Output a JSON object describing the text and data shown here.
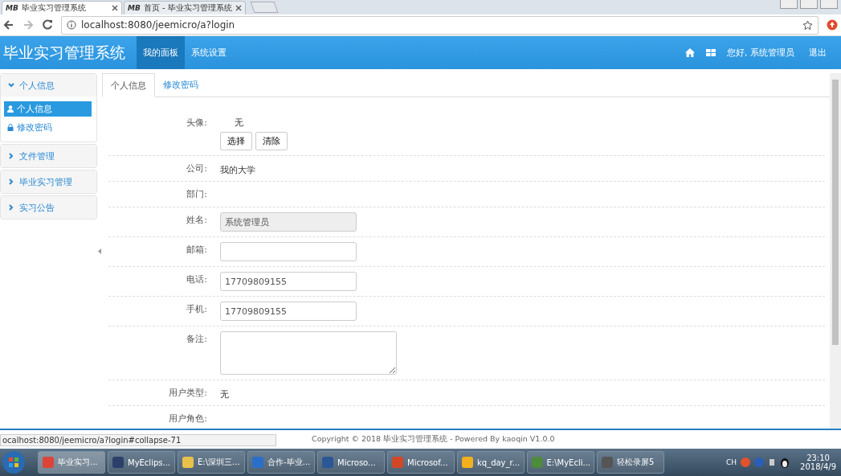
{
  "browser": {
    "tabs": [
      {
        "icon_text": "MB",
        "label": "毕业实习管理系统",
        "selected": true
      },
      {
        "icon_text": "MB",
        "label": "首页 - 毕业实习管理系统",
        "selected": false
      }
    ],
    "address": "localhost:8080/jeemicro/a?login"
  },
  "header": {
    "brand": "毕业实习管理系统",
    "nav": [
      {
        "label": "我的面板",
        "selected": true
      },
      {
        "label": "系统设置",
        "selected": false
      }
    ],
    "greeting": "您好, 系统管理员",
    "logout": "退出"
  },
  "sidebar": {
    "groups": [
      {
        "title": "个人信息",
        "expanded": true,
        "items": [
          {
            "label": "个人信息",
            "kind": "user",
            "selected": true
          },
          {
            "label": "修改密码",
            "kind": "lock",
            "selected": false
          }
        ]
      },
      {
        "title": "文件管理",
        "expanded": false
      },
      {
        "title": "毕业实习管理",
        "expanded": false
      },
      {
        "title": "实习公告",
        "expanded": false
      }
    ]
  },
  "tabs": [
    {
      "label": "个人信息",
      "selected": true
    },
    {
      "label": "修改密码",
      "selected": false
    }
  ],
  "form": {
    "rows": [
      {
        "kind": "avatar",
        "label": "头像:",
        "value": "无",
        "buttons": [
          "选择",
          "清除"
        ]
      },
      {
        "kind": "text",
        "label": "公司:",
        "value": "我的大学"
      },
      {
        "kind": "text",
        "label": "部门:"
      },
      {
        "kind": "input",
        "label": "姓名:",
        "value": "系统管理员",
        "disabled": true
      },
      {
        "kind": "input",
        "label": "邮箱:",
        "disabled": false
      },
      {
        "kind": "input",
        "label": "电话:",
        "value": "17709809155",
        "disabled": false
      },
      {
        "kind": "input",
        "label": "手机:",
        "value": "17709809155",
        "disabled": false
      },
      {
        "kind": "textarea",
        "label": "备注:"
      },
      {
        "kind": "text",
        "label": "用户类型:",
        "value": "无"
      },
      {
        "kind": "text",
        "label": "用户角色:"
      }
    ]
  },
  "footer": {
    "copyright": "Copyright © 2018 毕业实习管理系统 - Powered By kaoqin V1.0.0"
  },
  "status_bar": {
    "url": "ocalhost:8080/jeemicro/a?login#collapse-71"
  },
  "taskbar": {
    "items": [
      {
        "label": "毕业实习...",
        "color": "#db4437",
        "selected": true
      },
      {
        "label": "MyEclips...",
        "color": "#2b3f6b",
        "selected": false
      },
      {
        "label": "E:\\深圳三...",
        "color": "#e8c14a",
        "selected": false
      },
      {
        "label": "合作-毕业...",
        "color": "#2a6fc9",
        "selected": false
      },
      {
        "label": "Microso...",
        "color": "#2b5797",
        "selected": false
      },
      {
        "label": "Microsof...",
        "color": "#d24726",
        "selected": false
      },
      {
        "label": "kq_day_r...",
        "color": "#f2b01e",
        "selected": false
      },
      {
        "label": "E:\\MyEcli...",
        "color": "#4c8c3a",
        "selected": false
      },
      {
        "label": "轻松录屏5",
        "color": "#555555",
        "selected": false
      }
    ],
    "tray": {
      "lang": "CH",
      "time": "23:10",
      "date": "2018/4/9"
    }
  }
}
